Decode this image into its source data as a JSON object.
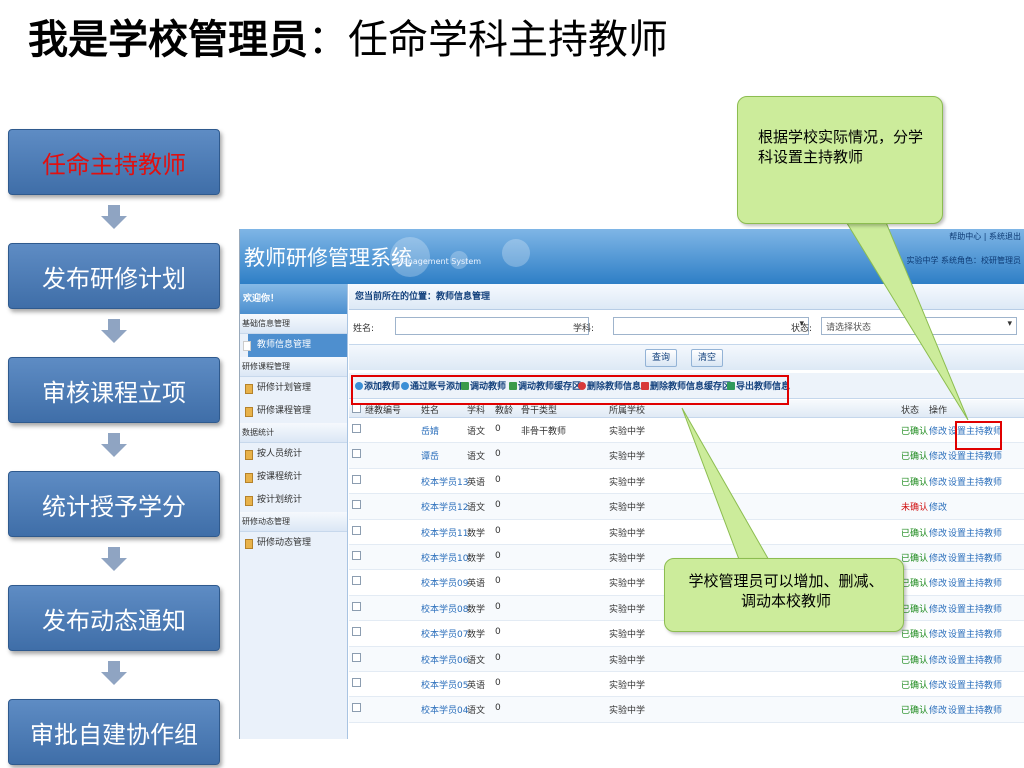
{
  "slide": {
    "title_bold": "我是学校管理员",
    "title_sep": "：",
    "title_rest": "任命学科主持教师"
  },
  "flow": [
    {
      "label": "任命主持教师"
    },
    {
      "label": "发布研修计划"
    },
    {
      "label": "审核课程立项"
    },
    {
      "label": "统计授予学分"
    },
    {
      "label": "发布动态通知"
    },
    {
      "label": "审批自建协作组"
    }
  ],
  "colors": {
    "flow_box": "#4f7fb8",
    "active_text": "#e01010",
    "callout": "#ccec9b",
    "highlight": "#e00000",
    "header": "#3d88cc"
  },
  "app": {
    "name": "教师研修管理系统",
    "subtitle": "Management System",
    "header_links": "帮助中心 | 系统退出",
    "header_user": "：实验中学  系统角色：校研管理员",
    "sidebar": {
      "welcome": "欢迎你！",
      "groups": [
        {
          "label": "基础信息管理",
          "items": [
            {
              "label": "教师信息管理"
            }
          ]
        },
        {
          "label": "研修课程管理",
          "items": [
            {
              "label": "研修计划管理"
            },
            {
              "label": "研修课程管理"
            }
          ]
        },
        {
          "label": "数据统计",
          "items": [
            {
              "label": "按人员统计"
            },
            {
              "label": "按课程统计"
            },
            {
              "label": "按计划统计"
            }
          ]
        },
        {
          "label": "研修动态管理",
          "items": [
            {
              "label": "研修动态管理"
            }
          ]
        }
      ]
    },
    "breadcrumb": "您当前所在的位置：教师信息管理",
    "search": {
      "name_label": "姓名:",
      "name_value": "",
      "subject_label": "学科:",
      "subject_value": "",
      "status_label": "状态:",
      "status_value": "请选择状态",
      "query_btn": "查询",
      "clear_btn": "清空"
    },
    "toolbar": [
      {
        "label": "添加教师",
        "icon": "add-icon"
      },
      {
        "label": "通过账号添加",
        "icon": "add-icon"
      },
      {
        "label": "调动教师",
        "icon": "transfer-icon"
      },
      {
        "label": "调动教师缓存区",
        "icon": "transfer-icon"
      },
      {
        "label": "删除教师信息",
        "icon": "delete-icon"
      },
      {
        "label": "删除教师信息缓存区",
        "icon": "delete-icon"
      },
      {
        "label": "导出教师信息",
        "icon": "export-icon"
      }
    ],
    "table": {
      "headers": [
        "继教编号",
        "姓名",
        "学科",
        "教龄",
        "骨干类型",
        "所属学校",
        "状态",
        "操作"
      ],
      "rows": [
        {
          "id": "",
          "name": "岳婧",
          "subject": "语文",
          "age": "0",
          "type": "非骨干教师",
          "school": "实验中学",
          "status": "已确认",
          "edit": "修改",
          "assign": "设置主持教师"
        },
        {
          "id": "",
          "name": "谭岳",
          "subject": "语文",
          "age": "0",
          "type": "",
          "school": "实验中学",
          "status": "已确认",
          "edit": "修改",
          "assign": "设置主持教师"
        },
        {
          "id": "",
          "name": "校本学员13",
          "subject": "英语",
          "age": "0",
          "type": "",
          "school": "实验中学",
          "status": "已确认",
          "edit": "修改",
          "assign": "设置主持教师"
        },
        {
          "id": "",
          "name": "校本学员12",
          "subject": "语文",
          "age": "0",
          "type": "",
          "school": "实验中学",
          "status": "未确认",
          "edit": "修改",
          "assign": ""
        },
        {
          "id": "",
          "name": "校本学员11",
          "subject": "数学",
          "age": "0",
          "type": "",
          "school": "实验中学",
          "status": "已确认",
          "edit": "修改",
          "assign": "设置主持教师"
        },
        {
          "id": "",
          "name": "校本学员10",
          "subject": "数学",
          "age": "0",
          "type": "",
          "school": "实验中学",
          "status": "已确认",
          "edit": "修改",
          "assign": "设置主持教师"
        },
        {
          "id": "",
          "name": "校本学员09",
          "subject": "英语",
          "age": "0",
          "type": "",
          "school": "实验中学",
          "status": "已确认",
          "edit": "修改",
          "assign": "设置主持教师"
        },
        {
          "id": "",
          "name": "校本学员08",
          "subject": "数学",
          "age": "0",
          "type": "",
          "school": "实验中学",
          "status": "已确认",
          "edit": "修改",
          "assign": "设置主持教师"
        },
        {
          "id": "",
          "name": "校本学员07",
          "subject": "数学",
          "age": "0",
          "type": "",
          "school": "实验中学",
          "status": "已确认",
          "edit": "修改",
          "assign": "设置主持教师"
        },
        {
          "id": "",
          "name": "校本学员06",
          "subject": "语文",
          "age": "0",
          "type": "",
          "school": "实验中学",
          "status": "已确认",
          "edit": "修改",
          "assign": "设置主持教师"
        },
        {
          "id": "",
          "name": "校本学员05",
          "subject": "英语",
          "age": "0",
          "type": "",
          "school": "实验中学",
          "status": "已确认",
          "edit": "修改",
          "assign": "设置主持教师"
        },
        {
          "id": "",
          "name": "校本学员04",
          "subject": "语文",
          "age": "0",
          "type": "",
          "school": "实验中学",
          "status": "已确认",
          "edit": "修改",
          "assign": "设置主持教师"
        }
      ]
    }
  },
  "callouts": {
    "top": "根据学校实际情况，分学科设置主持教师",
    "bottom": "学校管理员可以增加、删减、调动本校教师"
  }
}
